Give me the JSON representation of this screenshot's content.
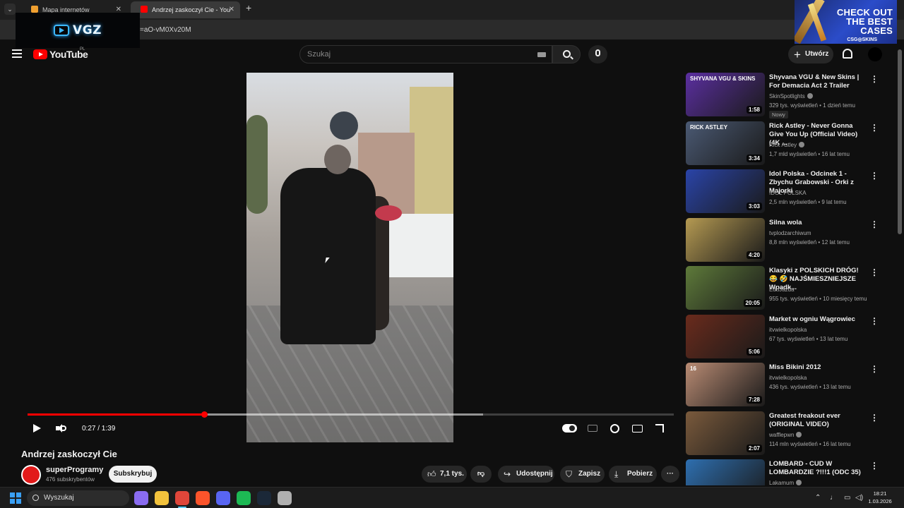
{
  "browser": {
    "tabs": [
      {
        "title": "Mapa internetów",
        "active": false
      },
      {
        "title": "Andrzej zaskoczył Cie - You",
        "active": true
      }
    ],
    "url": "=aO-vM0Xv20M"
  },
  "overlay_logo": "VGZ",
  "ad": {
    "line1": "CHECK OUT",
    "line2": "THE BEST",
    "line3": "CASES",
    "brand": "CSG◎SKINS"
  },
  "header": {
    "logo_text": "YouTube",
    "country": "PL",
    "search_placeholder": "Szukaj",
    "create_label": "Utwórz"
  },
  "player": {
    "time_display": "0:27 / 1:39",
    "progress_percent": 27.3,
    "buffered_percent": 70.5
  },
  "video": {
    "title": "Andrzej zaskoczył Cie",
    "channel": "superProgramy",
    "subscribers": "476 subskrybentów",
    "subscribe_label": "Subskrybuj",
    "likes": "7,1 tys.",
    "share_label": "Udostępnij",
    "save_label": "Zapisz",
    "download_label": "Pobierz"
  },
  "recommendations": [
    {
      "title": "Shyvana VGU & New Skins | For Demacia Act 2 Trailer",
      "channel": "SkinSpotlights",
      "verified": true,
      "meta": "329 tys. wyświetleń • 1 dzień temu",
      "duration": "1:58",
      "badge": "Nowy",
      "thumb_color": "#5b2fa0",
      "thumb_text": "SHYVANA VGU & SKINS"
    },
    {
      "title": "Rick Astley - Never Gonna Give You Up (Official Video) (4K ...",
      "channel": "Rick Astley",
      "verified": true,
      "meta": "1,7 mld wyświetleń • 16 lat temu",
      "duration": "3:34",
      "badge": "",
      "thumb_color": "#4b5a74",
      "thumb_text": "RICK ASTLEY"
    },
    {
      "title": "Idol Polska - Odcinek 1 - Zbychu Grabowski - Orki z Majorki",
      "channel": "IDOL POLSKA",
      "verified": false,
      "meta": "2,5 mln wyświetleń • 9 lat temu",
      "duration": "3:03",
      "badge": "",
      "thumb_color": "#2a44a8",
      "thumb_text": ""
    },
    {
      "title": "Silna wola",
      "channel": "tvplodzarchiwum",
      "verified": false,
      "meta": "8,8 mln wyświetleń • 12 lat temu",
      "duration": "4:20",
      "badge": "",
      "thumb_color": "#b59a52",
      "thumb_text": ""
    },
    {
      "title": "Klasyki z POLSKICH DRÓG! 😂 🤣 NAJŚMIESZNIEJSZE Wpadk...",
      "channel": "EduJazda",
      "verified": false,
      "meta": "955 tys. wyświetleń • 10 miesięcy temu",
      "duration": "20:05",
      "badge": "",
      "thumb_color": "#5e7a3a",
      "thumb_text": ""
    },
    {
      "title": "Market w ogniu Wągrowiec",
      "channel": "itvwielkopolska",
      "verified": false,
      "meta": "67 tys. wyświetleń • 13 lat temu",
      "duration": "5:06",
      "badge": "",
      "thumb_color": "#6a2b1c",
      "thumb_text": ""
    },
    {
      "title": "Miss Bikini 2012",
      "channel": "itvwielkopolska",
      "verified": false,
      "meta": "436 tys. wyświetleń • 13 lat temu",
      "duration": "7:28",
      "badge": "",
      "thumb_color": "#b98b73",
      "thumb_text": "16"
    },
    {
      "title": "Greatest freakout ever (ORIGINAL VIDEO)",
      "channel": "wafflepwn",
      "verified": true,
      "meta": "114 mln wyświetleń • 16 lat temu",
      "duration": "2:07",
      "badge": "",
      "thumb_color": "#7a5a3c",
      "thumb_text": ""
    },
    {
      "title": "LOMBARD - CUD W LOMBARDZIE ?!!!1 (ODC 35)",
      "channel": "Lakamum",
      "verified": true,
      "meta": "",
      "duration": "",
      "badge": "",
      "thumb_color": "#2e6fb0",
      "thumb_text": ""
    }
  ],
  "taskbar": {
    "search_label": "Wyszukaj",
    "time": "18:21",
    "date": "1.03.2026",
    "apps": [
      {
        "name": "copilot",
        "color": "#8a6cf0"
      },
      {
        "name": "explorer",
        "color": "#f2c23c"
      },
      {
        "name": "chrome",
        "color": "#e0463a"
      },
      {
        "name": "brave",
        "color": "#fb542b"
      },
      {
        "name": "discord",
        "color": "#5865f2"
      },
      {
        "name": "spotify",
        "color": "#1db954"
      },
      {
        "name": "steam",
        "color": "#1b2838"
      },
      {
        "name": "app",
        "color": "#b0b0b0"
      }
    ]
  }
}
